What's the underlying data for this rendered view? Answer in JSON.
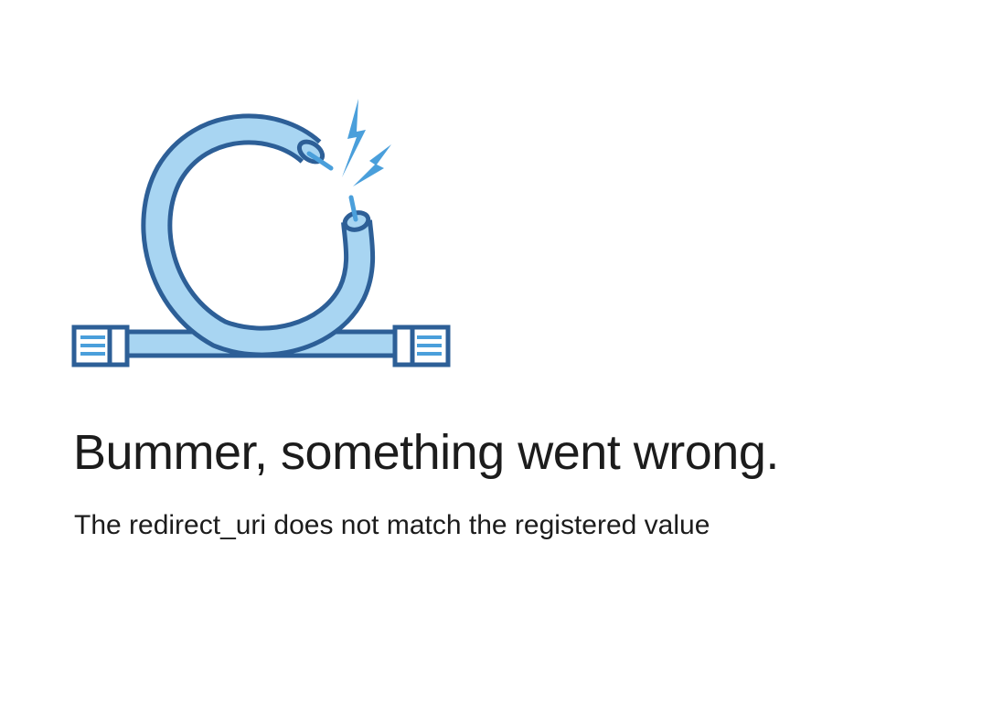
{
  "error": {
    "illustration_icon": "broken-cable-icon",
    "title": "Bummer, something went wrong.",
    "message": "The redirect_uri does not match the registered value"
  },
  "colors": {
    "cable_fill": "#a8d5f2",
    "cable_outline": "#2d5f97",
    "wire": "#4a9fdb",
    "spark": "#4a9fdb",
    "text": "#1c1c1c"
  }
}
